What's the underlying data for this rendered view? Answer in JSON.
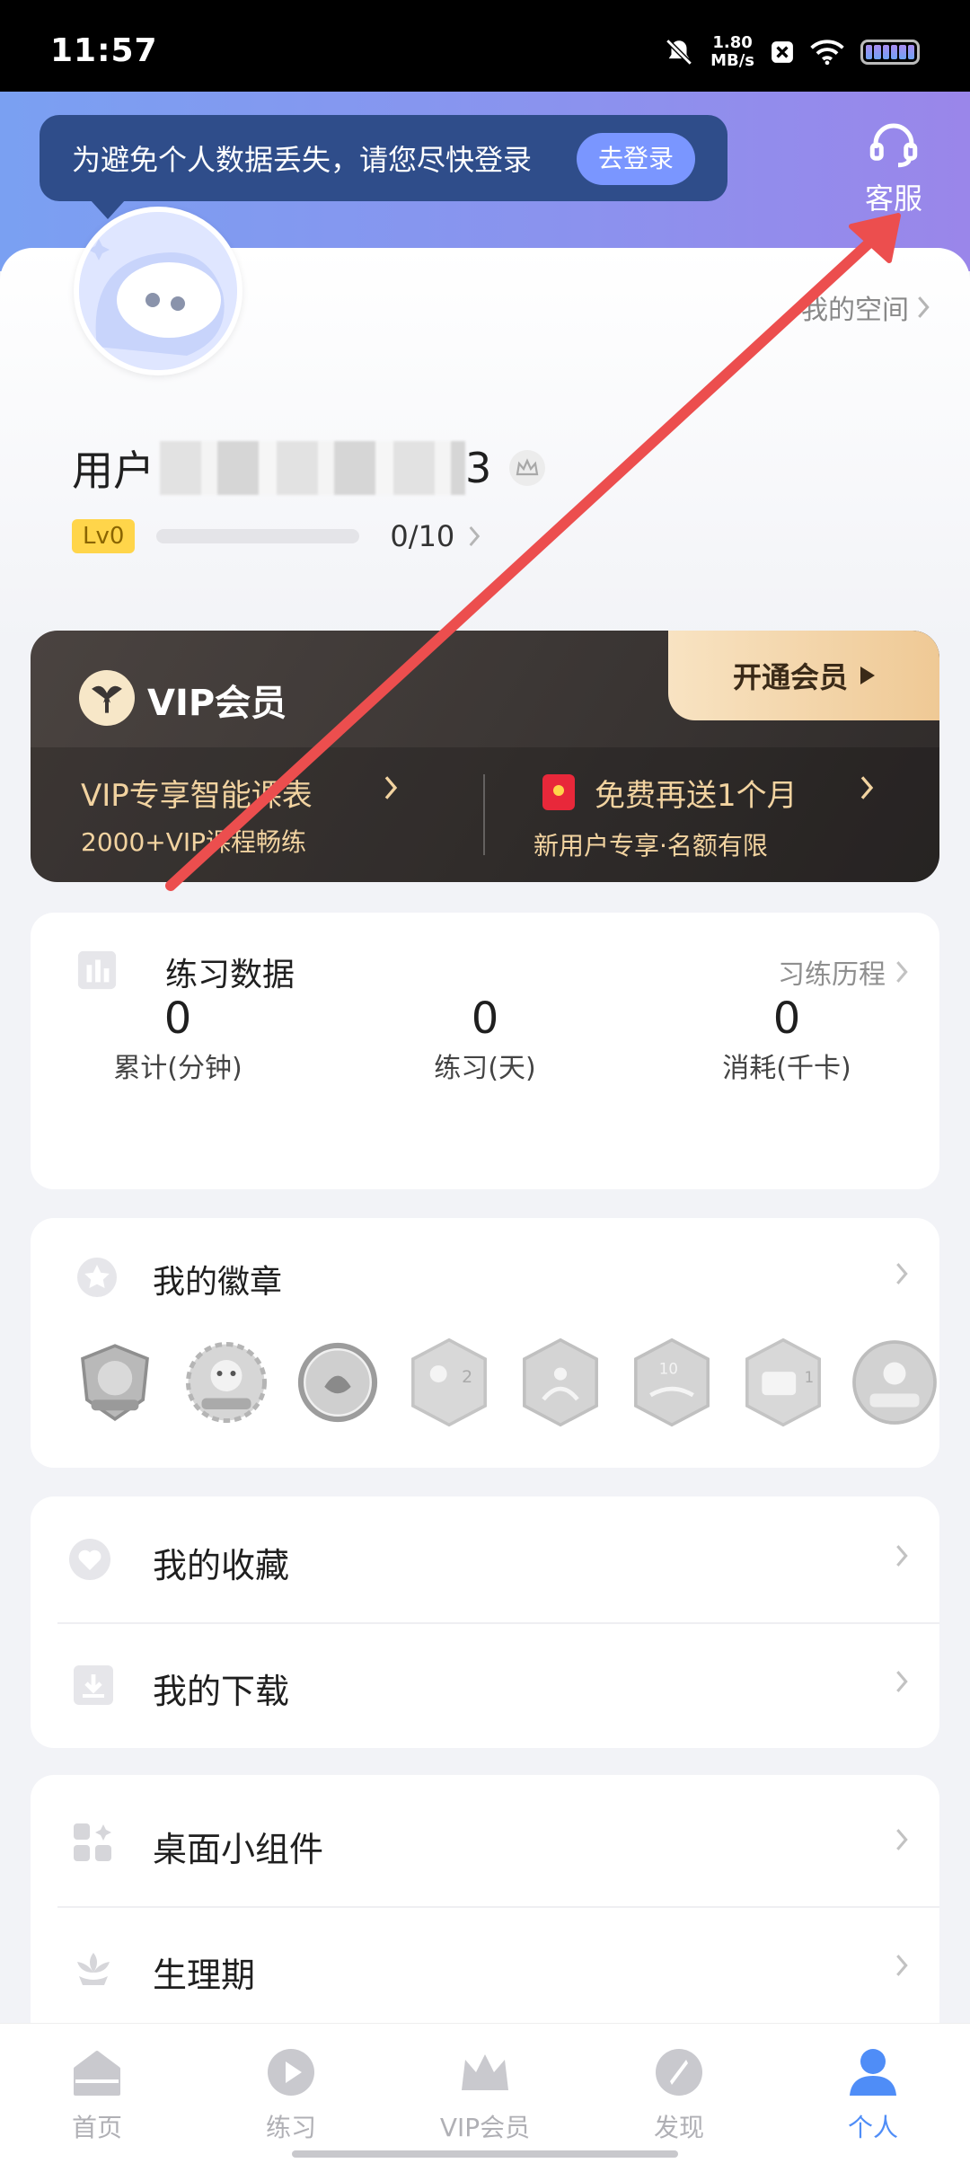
{
  "status_bar": {
    "time": "11:57",
    "speed_value": "1.80",
    "speed_unit": "MB/s"
  },
  "login_tip": {
    "text": "为避免个人数据丢失，请您尽快登录",
    "button": "去登录"
  },
  "service": {
    "label": "客服"
  },
  "profile": {
    "my_space": "我的空间",
    "username_prefix": "用户",
    "username_suffix": "3",
    "level_badge": "Lv0",
    "level_progress": "0/10",
    "level_fill": 0.0
  },
  "vip": {
    "title": "VIP会员",
    "open_button": "开通会员",
    "left_line1": "VIP专享智能课表",
    "left_line2": "2000+VIP课程畅练",
    "right_line1": "免费再送1个月",
    "right_line2": "新用户专享·名额有限"
  },
  "practice": {
    "title": "练习数据",
    "link": "习练历程",
    "stats": [
      {
        "value": "0",
        "label": "累计(分钟)"
      },
      {
        "value": "0",
        "label": "练习(天)"
      },
      {
        "value": "0",
        "label": "消耗(千卡)"
      }
    ]
  },
  "badges": {
    "title": "我的徽章"
  },
  "favorites": {
    "label": "我的收藏"
  },
  "downloads": {
    "label": "我的下载"
  },
  "widgets": {
    "label": "桌面小组件"
  },
  "period": {
    "label": "生理期"
  },
  "nav": [
    {
      "label": "首页",
      "icon": "home-icon"
    },
    {
      "label": "练习",
      "icon": "play-icon"
    },
    {
      "label": "VIP会员",
      "icon": "crown-icon"
    },
    {
      "label": "发现",
      "icon": "compass-icon"
    },
    {
      "label": "个人",
      "icon": "person-icon"
    }
  ],
  "colors": {
    "accent": "#4f8df7",
    "vip_gold": "#f2d3a0",
    "annotation_arrow": "#ec4e4e"
  }
}
